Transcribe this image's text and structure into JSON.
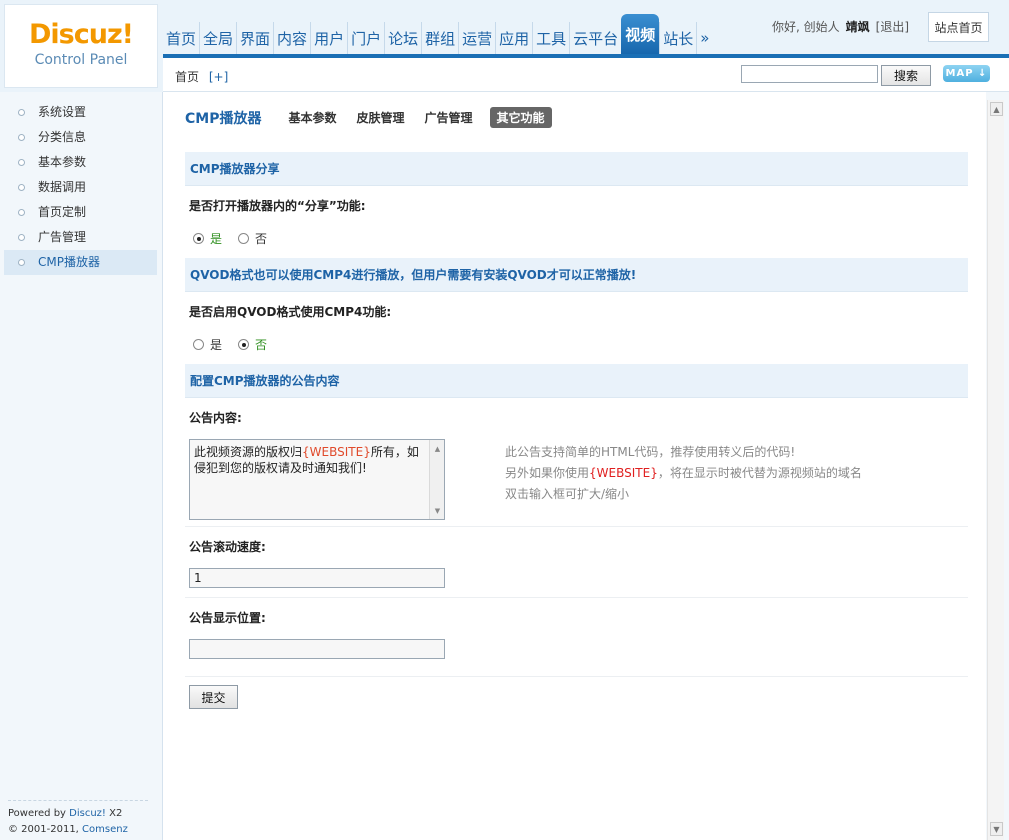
{
  "logo": {
    "brand": "Discuz!",
    "subtitle": "Control Panel"
  },
  "topnav": [
    {
      "label": "首页",
      "active": false
    },
    {
      "label": "全局",
      "active": false
    },
    {
      "label": "界面",
      "active": false
    },
    {
      "label": "内容",
      "active": false
    },
    {
      "label": "用户",
      "active": false
    },
    {
      "label": "门户",
      "active": false
    },
    {
      "label": "论坛",
      "active": false
    },
    {
      "label": "群组",
      "active": false
    },
    {
      "label": "运营",
      "active": false
    },
    {
      "label": "应用",
      "active": false
    },
    {
      "label": "工具",
      "active": false
    },
    {
      "label": "云平台",
      "active": false
    },
    {
      "label": "视频",
      "active": true
    },
    {
      "label": "站长",
      "active": false
    },
    {
      "label": "»",
      "active": false
    }
  ],
  "user": {
    "greeting": "你好, 创始人",
    "name": "靖飒",
    "logout": "[退出]",
    "site_home": "站点首页"
  },
  "breadcrumb": {
    "home": "首页",
    "add": "[+]"
  },
  "search": {
    "value": "",
    "button": "搜索",
    "map": "MAP ↓"
  },
  "sidebar": {
    "items": [
      {
        "label": "系统设置",
        "active": false
      },
      {
        "label": "分类信息",
        "active": false
      },
      {
        "label": "基本参数",
        "active": false
      },
      {
        "label": "数据调用",
        "active": false
      },
      {
        "label": "首页定制",
        "active": false
      },
      {
        "label": "广告管理",
        "active": false
      },
      {
        "label": "CMP播放器",
        "active": true
      }
    ],
    "footer": {
      "powered_prefix": "Powered by ",
      "powered_link": "Discuz!",
      "version": " X2",
      "copy_prefix": "© 2001-2011, ",
      "copy_link": "Comsenz Inc."
    }
  },
  "page": {
    "title": "CMP播放器",
    "tabs": [
      {
        "label": "基本参数",
        "active": false
      },
      {
        "label": "皮肤管理",
        "active": false
      },
      {
        "label": "广告管理",
        "active": false
      },
      {
        "label": "其它功能",
        "active": true
      }
    ]
  },
  "share": {
    "section": "CMP播放器分享",
    "question": "是否打开播放器内的“分享”功能:",
    "yes": "是",
    "no": "否",
    "selected": "yes"
  },
  "qvod": {
    "section": "QVOD格式也可以使用CMP4进行播放，但用户需要有安装QVOD才可以正常播放!",
    "question": "是否启用QVOD格式使用CMP4功能:",
    "yes": "是",
    "no": "否",
    "selected": "no"
  },
  "notice": {
    "section": "配置CMP播放器的公告内容",
    "content_label": "公告内容:",
    "content_pre": "此视频资源的版权归",
    "content_key": "{WEBSITE}",
    "content_post": "所有，如侵犯到您的版权请及时通知我们!",
    "tip1": "此公告支持简单的HTML代码，推荐使用转义后的代码!",
    "tip2_pre": "另外如果你使用",
    "tip2_key": "{WEBSITE}",
    "tip2_post": "，将在显示时被代替为源视频站的域名",
    "tip3": "双击输入框可扩大/缩小",
    "speed_label": "公告滚动速度:",
    "speed_value": "1",
    "position_label": "公告显示位置:",
    "position_value": ""
  },
  "submit": "提交"
}
